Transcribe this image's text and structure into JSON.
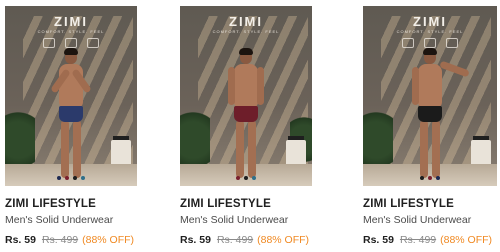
{
  "products": [
    {
      "image_logo": "ZIMI",
      "image_tagline": "COMFORT. STYLE. FEEL",
      "brand": "ZIMI LIFESTYLE",
      "title": "Men's Solid Underwear",
      "price": "Rs. 59",
      "mrp": "Rs. 499",
      "discount": "(88% OFF)",
      "brief_color": "#2b3a6b",
      "swatches": [
        "#1e2a52",
        "#7a1f2e",
        "#1f1f1f",
        "#2f6f8a"
      ]
    },
    {
      "image_logo": "ZIMI",
      "image_tagline": "COMFORT. STYLE. FEEL",
      "brand": "ZIMI LIFESTYLE",
      "title": "Men's Solid Underwear",
      "price": "Rs. 59",
      "mrp": "Rs. 499",
      "discount": "(88% OFF)",
      "brief_color": "#6e1e2a",
      "swatches": [
        "#7a1f2e",
        "#1f1f1f",
        "#2f6f8a"
      ]
    },
    {
      "image_logo": "ZIMI",
      "image_tagline": "COMFORT. STYLE. FEEL",
      "brand": "ZIMI LIFESTYLE",
      "title": "Men's Solid Underwear",
      "price": "Rs. 59",
      "mrp": "Rs. 499",
      "discount": "(88% OFF)",
      "brief_color": "#1b1b1b",
      "swatches": [
        "#1f1f1f",
        "#7a1f2e",
        "#1e2a52"
      ]
    }
  ]
}
